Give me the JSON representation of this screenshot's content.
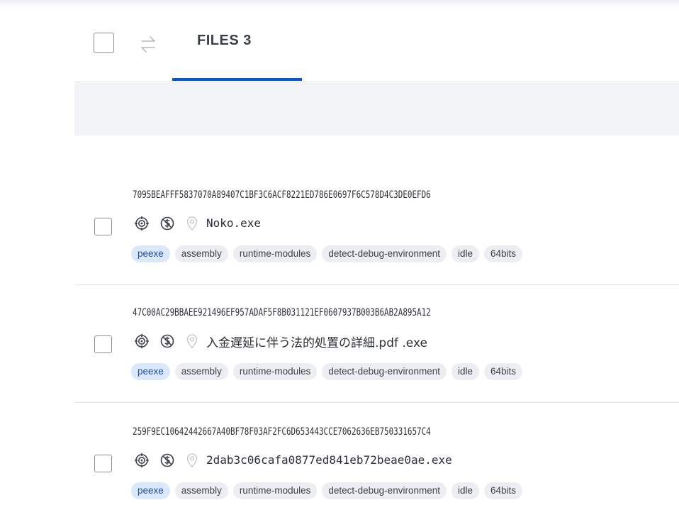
{
  "header": {
    "tab_label": "FILES 3"
  },
  "icons": {
    "header": [
      "checkbox-icon",
      "swap-arrows-icon"
    ],
    "row": [
      "target-icon",
      "no-dollar-icon",
      "location-pin-icon"
    ]
  },
  "colors": {
    "accent": "#0b57d0",
    "tag_blue_bg": "#dbe8fb",
    "tag_gray_bg": "#eceef1"
  },
  "files": [
    {
      "hash": "7095BEAFFF5837070A89407C1BF3C6ACF8221ED786E0697F6C578D4C3DE0EFD6",
      "name": "Noko.exe",
      "tags": [
        "peexe",
        "assembly",
        "runtime-modules",
        "detect-debug-environment",
        "idle",
        "64bits"
      ]
    },
    {
      "hash": "47C00AC29BBAEE921496EF957ADAF5F8B031121EF0607937B003B6AB2A895A12",
      "name": "入金遅延に伴う法的処置の詳細.pdf .exe",
      "tags": [
        "peexe",
        "assembly",
        "runtime-modules",
        "detect-debug-environment",
        "idle",
        "64bits"
      ]
    },
    {
      "hash": "259F9EC10642442667A40BF78F03AF2FC6D653443CCE7062636EB750331657C4",
      "name": "2dab3c06cafa0877ed841eb72beae0ae.exe",
      "tags": [
        "peexe",
        "assembly",
        "runtime-modules",
        "detect-debug-environment",
        "idle",
        "64bits"
      ]
    }
  ]
}
